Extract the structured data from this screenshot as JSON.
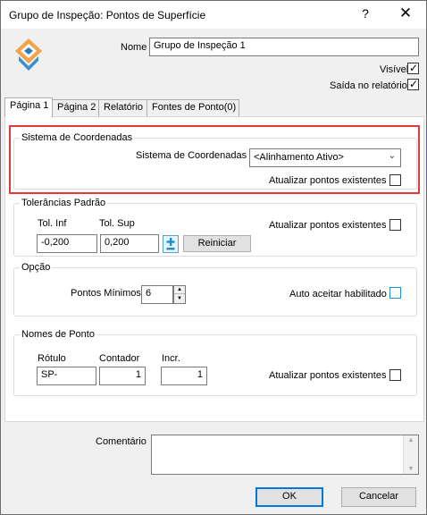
{
  "window": {
    "title": "Grupo de Inspeção: Pontos de Superfície",
    "help": "?",
    "close": "✕"
  },
  "header": {
    "name_label": "Nome",
    "name_value": "Grupo de Inspeção 1",
    "visible_label": "Visível",
    "visible_checked": true,
    "output_label": "Saída no relatório",
    "output_checked": true
  },
  "tabs": [
    {
      "label": "Página 1",
      "active": true
    },
    {
      "label": "Página 2",
      "active": false
    },
    {
      "label": "Relatório",
      "active": false
    },
    {
      "label": "Fontes de Ponto(0)",
      "active": false
    }
  ],
  "coord": {
    "group_title": "Sistema de Coordenadas",
    "field_label": "Sistema de Coordenadas",
    "selected": "<Alinhamento Ativo>",
    "update_label": "Atualizar pontos existentes"
  },
  "tolerance": {
    "group_title": "Tolerâncias Padrão",
    "inf_label": "Tol. Inf",
    "sup_label": "Tol. Sup",
    "inf_value": "-0,200",
    "sup_value": "0,200",
    "reset_label": "Reiniciar",
    "update_label": "Atualizar pontos existentes"
  },
  "option": {
    "group_title": "Opção",
    "min_points_label": "Pontos Mínimos",
    "min_points_value": "6",
    "auto_accept_label": "Auto aceitar habilitado"
  },
  "point_names": {
    "group_title": "Nomes de Ponto",
    "label_label": "Rótulo",
    "counter_label": "Contador",
    "incr_label": "Incr.",
    "label_value": "SP-",
    "counter_value": "1",
    "incr_value": "1",
    "update_label": "Atualizar pontos existentes"
  },
  "footer": {
    "comment_label": "Comentário",
    "comment_value": "",
    "ok_label": "OK",
    "cancel_label": "Cancelar"
  },
  "colors": {
    "highlight": "#e03c36",
    "accent": "#0078d7"
  }
}
